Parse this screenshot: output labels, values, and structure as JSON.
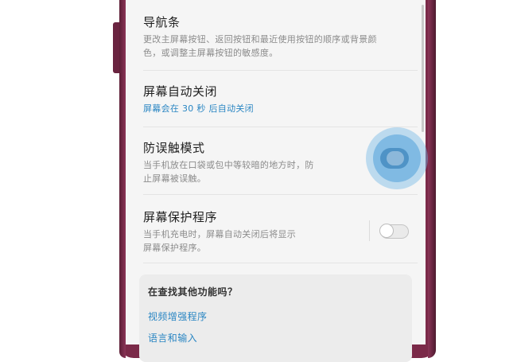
{
  "settings": {
    "navigation_bar": {
      "title": "导航条",
      "desc_line1": "更改主屏幕按钮、返回按钮和最近使用按钮的顺序或背景颜",
      "desc_line2": "色，或调整主屏幕按钮的敏感度。"
    },
    "screen_timeout": {
      "title": "屏幕自动关闭",
      "desc": "屏幕会在 30 秒 后自动关闭"
    },
    "accidental_touch": {
      "title": "防误触模式",
      "desc_line1": "当手机放在口袋或包中等较暗的地方时，防",
      "desc_line2": "止屏幕被误触。",
      "toggle_on": false
    },
    "screen_saver": {
      "title": "屏幕保护程序",
      "desc_line1": "当手机充电时，屏幕自动关闭后将显示",
      "desc_line2": "屏幕保护程序。",
      "toggle_on": false
    }
  },
  "suggestions": {
    "title": "在查找其他功能吗？",
    "links": [
      "视频增强程序",
      "语言和输入"
    ]
  },
  "colors": {
    "accent": "#2a86c3",
    "phone_frame": "#7b2a49"
  }
}
